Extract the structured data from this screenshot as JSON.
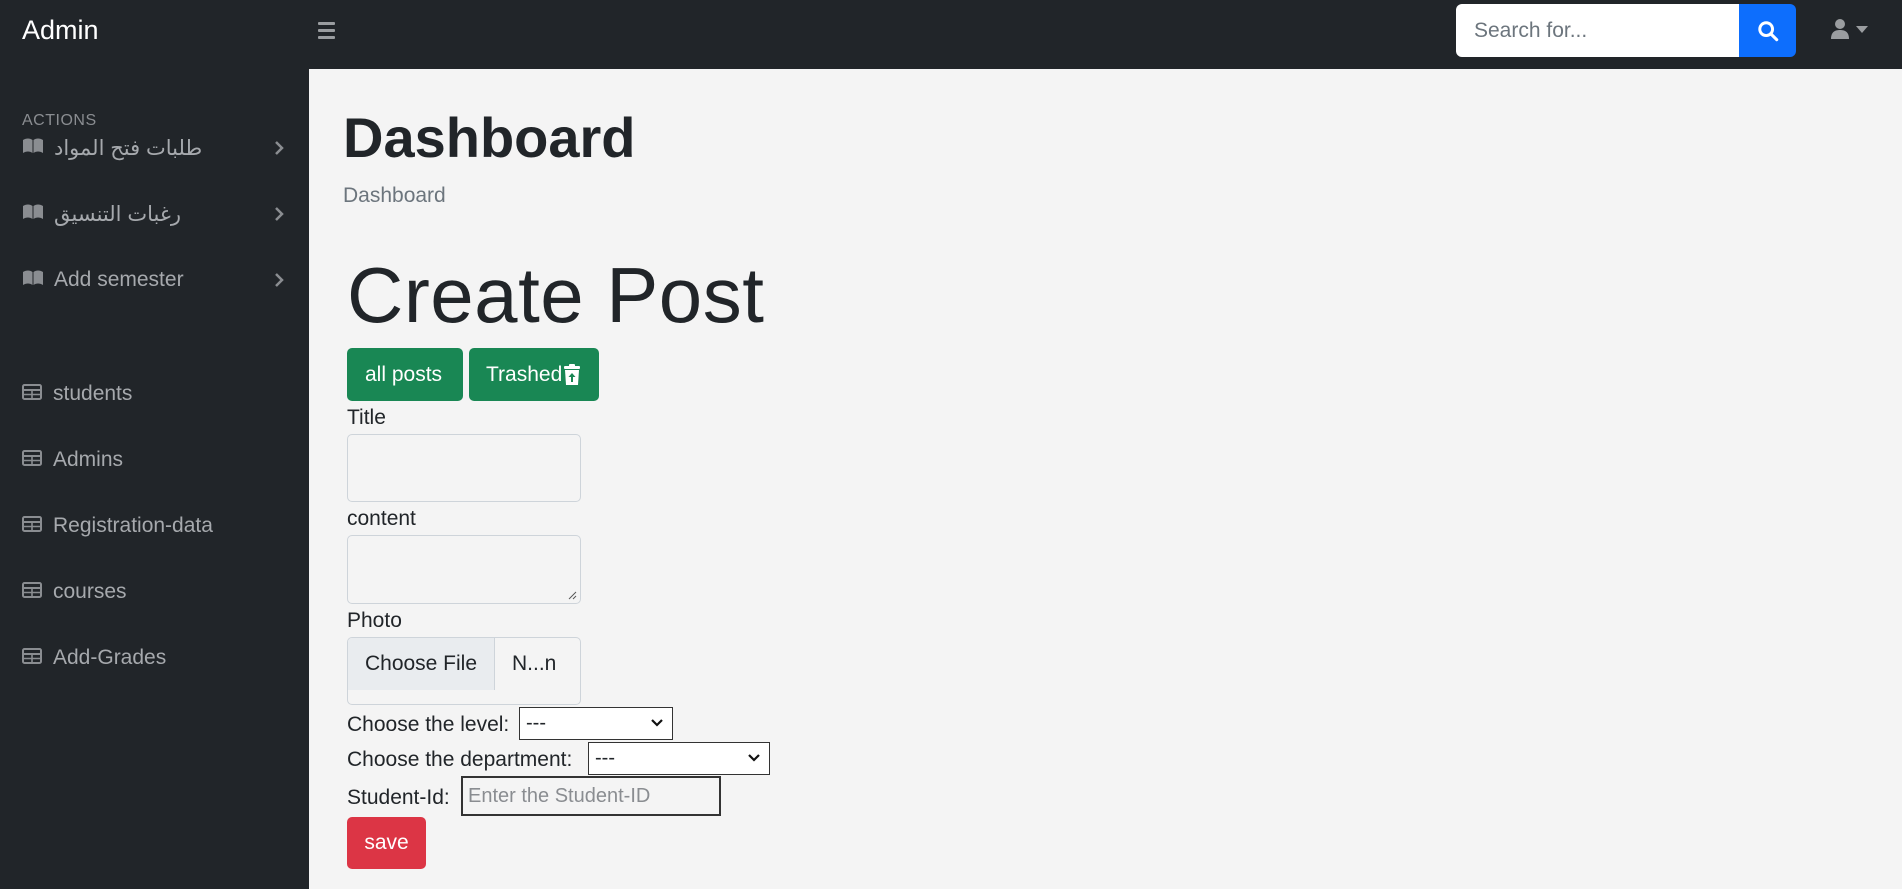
{
  "navbar": {
    "brand": "Admin",
    "search_placeholder": "Search for...",
    "toggle_icon": "menu-icon",
    "search_icon": "search-icon",
    "user_icon": "user-icon"
  },
  "sidebar": {
    "heading": "ACTIONS",
    "action_items": [
      {
        "label": "طلبات فتح المواد",
        "icon": "book-icon"
      },
      {
        "label": "رغبات التنسيق",
        "icon": "book-icon"
      },
      {
        "label": "Add semester",
        "icon": "book-icon"
      }
    ],
    "table_items": [
      {
        "label": "students",
        "icon": "table-icon"
      },
      {
        "label": "Admins",
        "icon": "table-icon"
      },
      {
        "label": "Registration-data",
        "icon": "table-icon"
      },
      {
        "label": "courses",
        "icon": "table-icon"
      },
      {
        "label": "Add-Grades",
        "icon": "table-icon"
      }
    ]
  },
  "main": {
    "page_title": "Dashboard",
    "breadcrumb": "Dashboard",
    "form_heading": "Create Post",
    "buttons": {
      "all_posts": "all posts",
      "trashed": "Trashed"
    },
    "form": {
      "title_label": "Title",
      "title_value": "",
      "content_label": "content",
      "content_value": "",
      "photo_label": "Photo",
      "choose_file": "Choose File",
      "file_name": "N...n",
      "level_label": "Choose the level:",
      "level_value": "---",
      "department_label": "Choose the department:",
      "department_value": "---",
      "student_id_label": "Student-Id:",
      "student_id_placeholder": "Enter the Student-ID",
      "save": "save"
    }
  },
  "colors": {
    "navbar_bg": "#212529",
    "primary": "#0d6efd",
    "success": "#198754",
    "danger": "#dc3545",
    "page_bg": "#f4f4f4"
  }
}
